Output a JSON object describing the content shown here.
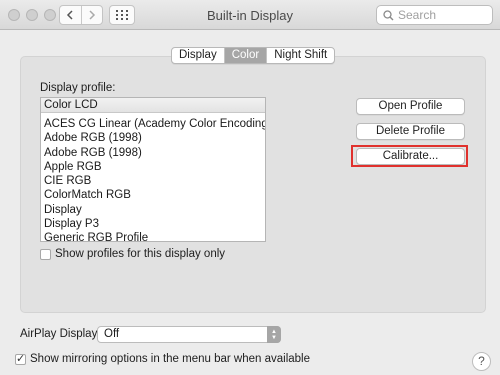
{
  "window": {
    "title": "Built-in Display"
  },
  "search": {
    "placeholder": "Search"
  },
  "tabs": [
    {
      "label": "Display"
    },
    {
      "label": "Color",
      "active": true
    },
    {
      "label": "Night Shift"
    }
  ],
  "color": {
    "display_profile_label": "Display profile:",
    "selected_profile": "Color LCD",
    "profiles": [
      "ACES CG Linear (Academy Color Encoding Sy...",
      "Adobe RGB (1998)",
      "Adobe RGB (1998)",
      "Apple RGB",
      "CIE RGB",
      "ColorMatch RGB",
      "Display",
      "Display P3",
      "Generic RGB Profile"
    ],
    "show_only_label": "Show profiles for this display only",
    "show_only_checked": false,
    "buttons": {
      "open": "Open Profile",
      "delete": "Delete Profile",
      "calibrate": "Calibrate..."
    }
  },
  "airplay": {
    "label": "AirPlay Display:",
    "value": "Off"
  },
  "mirroring": {
    "label": "Show mirroring options in the menu bar when available",
    "checked": true
  },
  "help": {
    "symbol": "?"
  },
  "colors": {
    "highlight": "#e0312d",
    "active_tab": "#a6a6a6"
  }
}
